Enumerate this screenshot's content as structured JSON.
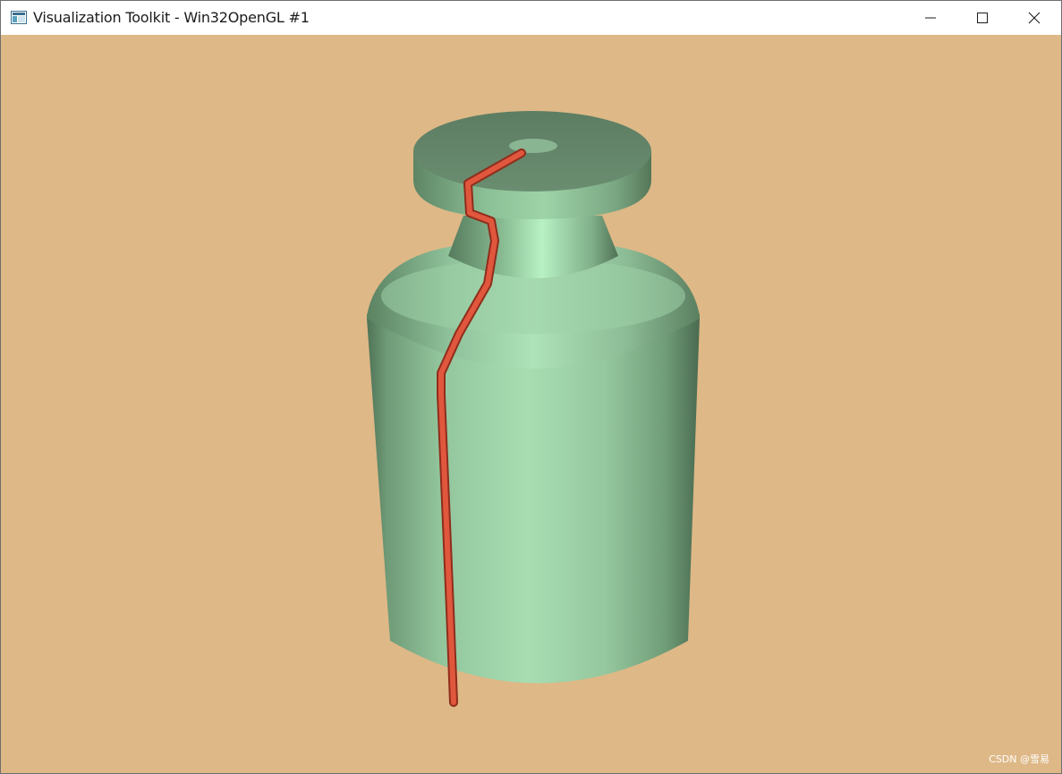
{
  "window": {
    "title": "Visualization Toolkit - Win32OpenGL #1",
    "app_icon": "vtk-window-icon",
    "controls": {
      "minimize_icon": "minimize-icon",
      "maximize_icon": "maximize-icon",
      "close_icon": "close-icon"
    }
  },
  "viewport": {
    "background_color": "#deb887",
    "objects": [
      {
        "name": "bottle-mesh",
        "color": "#a8ddb0"
      },
      {
        "name": "streamline-tube",
        "color": "#d9553c"
      }
    ]
  },
  "watermark": "CSDN @雪易"
}
